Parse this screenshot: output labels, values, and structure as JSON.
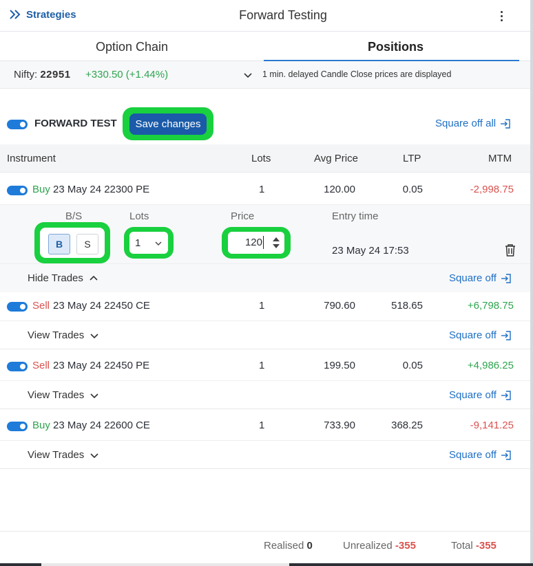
{
  "header": {
    "back_label": "Strategies",
    "title": "Forward Testing"
  },
  "tabs": [
    {
      "label": "Option Chain",
      "active": false
    },
    {
      "label": "Positions",
      "active": true
    }
  ],
  "ticker": {
    "symbol_label": "Nifty:",
    "price": "22951",
    "change": "+330.50 (+1.44%)",
    "note": "1 min. delayed Candle Close prices are displayed"
  },
  "forward": {
    "label": "FORWARD TEST",
    "save_label": "Save changes",
    "square_off_all": "Square off all"
  },
  "columns": {
    "instrument": "Instrument",
    "lots": "Lots",
    "avg": "Avg Price",
    "ltp": "LTP",
    "mtm": "MTM"
  },
  "positions": [
    {
      "side": "Buy",
      "instrument": "23 May 24 22300 PE",
      "lots": "1",
      "avg": "120.00",
      "ltp": "0.05",
      "mtm": "-2,998.75",
      "toggle": "Hide Trades",
      "square_off": "Square off"
    },
    {
      "side": "Sell",
      "instrument": "23 May 24 22450 CE",
      "lots": "1",
      "avg": "790.60",
      "ltp": "518.65",
      "mtm": "+6,798.75",
      "toggle": "View Trades",
      "square_off": "Square off"
    },
    {
      "side": "Sell",
      "instrument": "23 May 24 22450 PE",
      "lots": "1",
      "avg": "199.50",
      "ltp": "0.05",
      "mtm": "+4,986.25",
      "toggle": "View Trades",
      "square_off": "Square off"
    },
    {
      "side": "Buy",
      "instrument": "23 May 24 22600 CE",
      "lots": "1",
      "avg": "733.90",
      "ltp": "368.25",
      "mtm": "-9,141.25",
      "toggle": "View Trades",
      "square_off": "Square off"
    }
  ],
  "trade_detail": {
    "bs_header": "B/S",
    "lots_header": "Lots",
    "price_header": "Price",
    "entry_header": "Entry time",
    "buy_label": "B",
    "sell_label": "S",
    "lots_value": "1",
    "price_value": "120",
    "entry_time": "23 May 24 17:53"
  },
  "summary": {
    "realised_label": "Realised",
    "realised_value": "0",
    "unrealized_label": "Unrealized",
    "unrealized_value": "-355",
    "total_label": "Total",
    "total_value": "-355"
  },
  "colors": {
    "accent": "#1e7bd9",
    "highlight": "#19d03f",
    "positive": "#2ea44f",
    "negative": "#d9534f"
  }
}
